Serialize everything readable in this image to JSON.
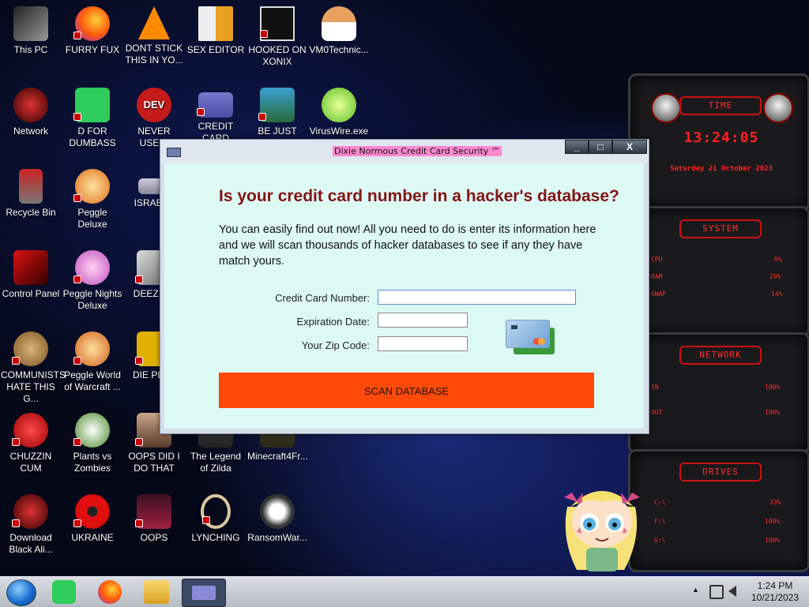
{
  "desktop_icons": [
    {
      "label": "This PC"
    },
    {
      "label": "FURRY FUX"
    },
    {
      "label": "DONT STICK THIS IN YO..."
    },
    {
      "label": "SEX EDITOR"
    },
    {
      "label": "HOOKED ON XONIX"
    },
    {
      "label": "VM0Technic..."
    },
    {
      "label": "Network"
    },
    {
      "label": "D FOR DUMBASS"
    },
    {
      "label": "NEVER USED!"
    },
    {
      "label": "CREDIT CARD CHECKER"
    },
    {
      "label": "BE JUST LIKE THE DUDE!"
    },
    {
      "label": "VirusWire.exe"
    },
    {
      "label": "Recycle Bin"
    },
    {
      "label": "Peggle Deluxe"
    },
    {
      "label": "ISRAELS"
    },
    {
      "label": "Control Panel"
    },
    {
      "label": "Peggle Nights Deluxe"
    },
    {
      "label": "DEEZ NU"
    },
    {
      "label": "COMMUNISTS HATE THIS G..."
    },
    {
      "label": "Peggle World of Warcraft ..."
    },
    {
      "label": "DIE PLEA"
    },
    {
      "label": "CHUZZIN CUM"
    },
    {
      "label": "Plants vs Zombies"
    },
    {
      "label": "OOPS DID I DO THAT"
    },
    {
      "label": "The Legend of Zilda"
    },
    {
      "label": "Minecraft4Fr..."
    },
    {
      "label": "Download Black Ali..."
    },
    {
      "label": "UKRAINE"
    },
    {
      "label": "OOPS"
    },
    {
      "label": "LYNCHING"
    },
    {
      "label": "RansomWar..."
    }
  ],
  "gadget": {
    "time_title": "TIME",
    "clock": "13:24:05",
    "date": "Saturday 21 October 2023",
    "system_title": "SYSTEM",
    "cpu_label": "CPU",
    "cpu_value": "6%",
    "ram_label": "RAM",
    "ram_value": "29%",
    "swap_label": "SWAP",
    "swap_value": "14%",
    "network_title": "NETWORK",
    "in_label": "IN",
    "in_value": "100%",
    "out_label": "OUT",
    "out_value": "100%",
    "drives_title": "DRIVES",
    "drive_c": "C:\\",
    "drive_c_value": "33%",
    "drive_f": "F:\\",
    "drive_f_value": "100%",
    "drive_g": "G:\\",
    "drive_g_value": "100%"
  },
  "app": {
    "window_title": "Dixie Normous Credit Card Security ™",
    "minimize": "_",
    "maximize": "□",
    "close": "X",
    "headline": "Is your credit card number in a hacker's database?",
    "intro": "You can easily find out now! All you need to do is enter its information here and we will scan thousands of hacker databases to see if any they have match yours.",
    "cc_label": "Credit Card Number:",
    "cc_value": "",
    "exp_label": "Expiration Date:",
    "exp_value": "",
    "zip_label": "Your Zip Code:",
    "zip_value": "",
    "scan_button": "SCAN DATABASE"
  },
  "taskbar": {
    "time": "1:24 PM",
    "date": "10/21/2023",
    "tray_arrow": "▲"
  }
}
